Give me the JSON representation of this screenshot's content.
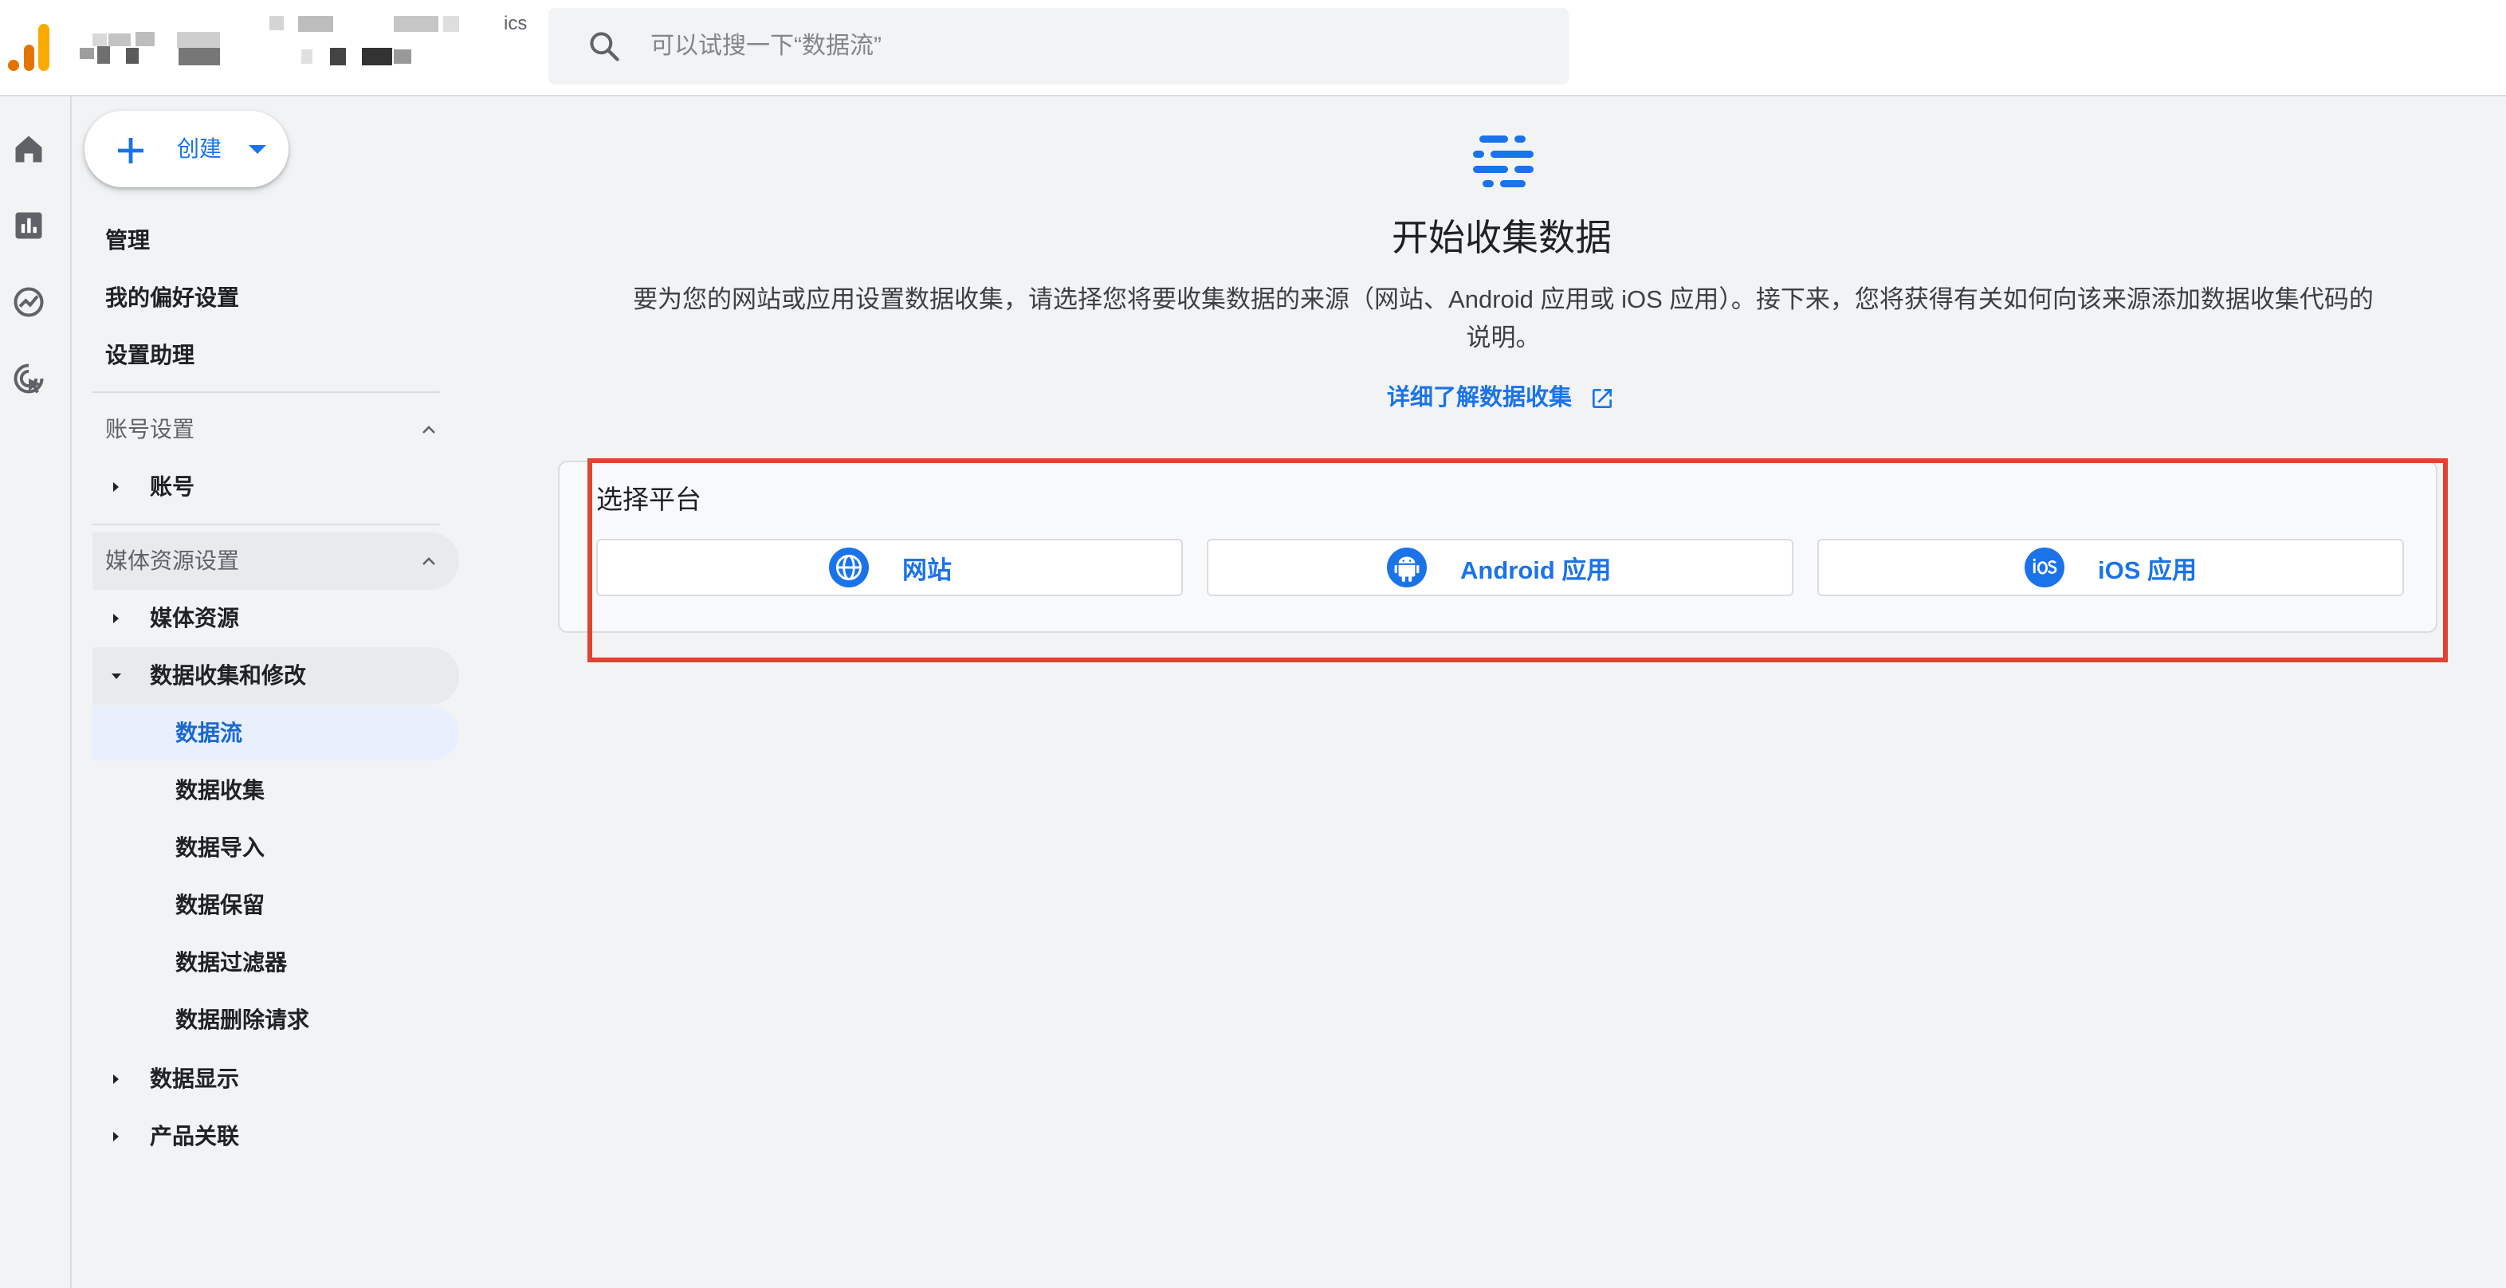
{
  "header": {
    "app_name_suffix": "ics",
    "search_placeholder": "可以试搜一下“数据流”"
  },
  "rail": {
    "items": [
      "home-icon",
      "reports-icon",
      "explore-icon",
      "advertising-icon"
    ]
  },
  "sidenav": {
    "create_label": "创建",
    "top_items": [
      "管理",
      "我的偏好设置",
      "设置助理"
    ],
    "account_section": {
      "title": "账号设置",
      "items": [
        "账号"
      ]
    },
    "property_section": {
      "title": "媒体资源设置",
      "items": [
        "媒体资源",
        "数据收集和修改"
      ],
      "sub_items": [
        "数据流",
        "数据收集",
        "数据导入",
        "数据保留",
        "数据过滤器",
        "数据删除请求"
      ],
      "selected_sub_item": "数据流",
      "after_items": [
        "数据显示",
        "产品关联"
      ]
    }
  },
  "main": {
    "title": "开始收集数据",
    "description": "要为您的网站或应用设置数据收集，请选择您将要收集数据的来源（网站、Android 应用或 iOS 应用）。接下来，您将获得有关如何向该来源添加数据收集代码的说明。",
    "learn_more": "详细了解数据收集",
    "platform_card": {
      "title": "选择平台",
      "buttons": [
        {
          "label": "网站",
          "icon": "globe-icon"
        },
        {
          "label": "Android 应用",
          "icon": "android-icon"
        },
        {
          "label": "iOS 应用",
          "icon": "ios-icon"
        }
      ]
    }
  },
  "colors": {
    "accent": "#1a73e8",
    "highlight_box": "#e0432f",
    "selected_bg": "#e8f0fe",
    "logo_orange": "#e37400",
    "logo_yellow": "#f9ab00"
  }
}
